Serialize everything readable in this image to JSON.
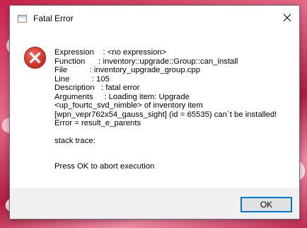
{
  "window": {
    "title": "Fatal Error",
    "icon": "application-window-icon",
    "close_icon": "close-icon"
  },
  "dialog": {
    "icon": "error-icon",
    "icon_color": "#d8332a",
    "lines": [
      "Expression    : <no expression>",
      "Function      : inventory::upgrade::Group::can_install",
      "File          : inventory_upgrade_group.cpp",
      "Line          : 105",
      "Description   : fatal error",
      "Arguments     : Loading item: Upgrade",
      "<up_fourtc_svd_nimble> of inventory item",
      "[wpn_vepr762x54_gauss_sight] (id = 65535) can`t be installed!",
      "Error = result_e_parents"
    ],
    "stack_trace_label": "stack trace:",
    "footer_message": "Press OK to abort execution"
  },
  "buttons": {
    "ok_label": "OK",
    "accent": "#0078d7"
  }
}
